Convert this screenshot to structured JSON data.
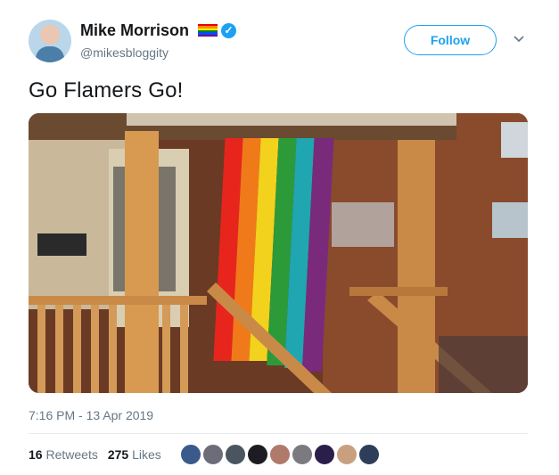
{
  "author": {
    "name": "Mike Morrison",
    "handle": "@mikesbloggity",
    "verified": true,
    "name_badge_icon": "rainbow-flag-emoji"
  },
  "follow_button": {
    "label": "Follow"
  },
  "menu_icon": "chevron-down-icon",
  "tweet": {
    "text": "Go Flamers Go!",
    "media_icon": "photo",
    "timestamp": "7:16 PM - 13 Apr 2019"
  },
  "stats": {
    "retweets_count": "16",
    "retweets_label": "Retweets",
    "likes_count": "275",
    "likes_label": "Likes"
  },
  "likers": [
    "#3a5a8c",
    "#6d6d7a",
    "#4a5560",
    "#1c1c22",
    "#b07a6a",
    "#7a7a80",
    "#2a1e4a",
    "#c8a080",
    "#2c3e5a"
  ],
  "colors": {
    "accent": "#1da1f2",
    "text": "#14171a",
    "muted": "#657786"
  }
}
